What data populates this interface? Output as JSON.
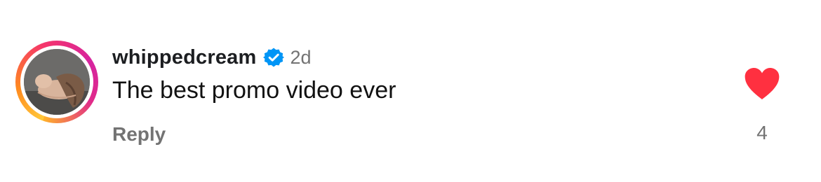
{
  "comment": {
    "username": "whippedcream",
    "verified": true,
    "timestamp": "2d",
    "text": "The best promo video ever",
    "reply_label": "Reply",
    "like_count": "4",
    "liked": true
  },
  "colors": {
    "like_heart": "#ff3040",
    "verified_badge": "#0095f6",
    "secondary_text": "#737373",
    "primary_text": "#111111"
  },
  "icons": {
    "verified": "verified-badge-icon",
    "like": "heart-filled-icon"
  }
}
